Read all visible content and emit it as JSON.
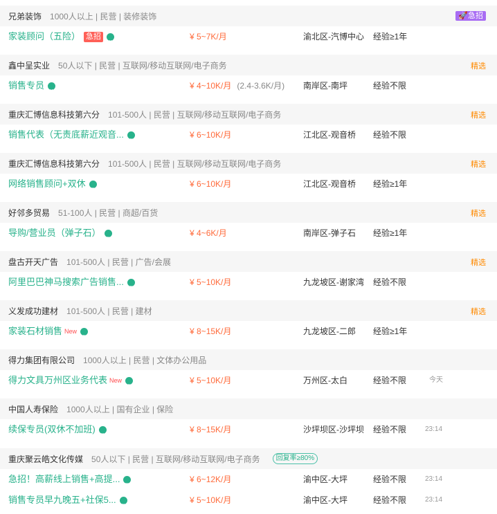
{
  "listings": [
    {
      "company": "兄弟装饰",
      "meta": "1000人以上 | 民营 | 装修装饰",
      "tag": "急招",
      "tag_type": "urgent",
      "jobs": [
        {
          "title": "家装顾问（五险）",
          "jizhao": "急招",
          "salary": "¥ 5~7K/月",
          "location": "渝北区-汽博中心",
          "exp": "经验≥1年"
        }
      ]
    },
    {
      "company": "鑫中呈实业",
      "meta": "50人以下 | 民营 | 互联网/移动互联网/电子商务",
      "tag": "精选",
      "tag_type": "featured",
      "jobs": [
        {
          "title": "销售专员",
          "salary": "¥ 4~10K/月",
          "salary_extra": "(2.4-3.6K/月)",
          "location": "南岸区-南坪",
          "exp": "经验不限"
        }
      ]
    },
    {
      "company": "重庆汇博信息科技第六分",
      "meta": "101-500人 | 民营 | 互联网/移动互联网/电子商务",
      "tag": "精选",
      "tag_type": "featured",
      "jobs": [
        {
          "title": "销售代表（无责底薪近观音...",
          "salary": "¥ 6~10K/月",
          "location": "江北区-观音桥",
          "exp": "经验不限"
        }
      ]
    },
    {
      "company": "重庆汇博信息科技第六分",
      "meta": "101-500人 | 民营 | 互联网/移动互联网/电子商务",
      "tag": "精选",
      "tag_type": "featured",
      "jobs": [
        {
          "title": "网络销售顾问+双休",
          "salary": "¥ 6~10K/月",
          "location": "江北区-观音桥",
          "exp": "经验≥1年"
        }
      ]
    },
    {
      "company": "好邻多贸易",
      "meta": "51-100人 | 民营 | 商超/百货",
      "tag": "精选",
      "tag_type": "featured",
      "jobs": [
        {
          "title": "导购/营业员（弹子石）",
          "salary": "¥ 4~6K/月",
          "location": "南岸区-弹子石",
          "exp": "经验≥1年"
        }
      ]
    },
    {
      "company": "盘古开天广告",
      "meta": "101-500人 | 民营 | 广告/会展",
      "tag": "精选",
      "tag_type": "featured",
      "jobs": [
        {
          "title": "阿里巴巴神马搜索广告销售...",
          "salary": "¥ 5~10K/月",
          "location": "九龙坡区-谢家湾",
          "exp": "经验不限"
        }
      ]
    },
    {
      "company": "义发成功建材",
      "meta": "101-500人 | 民营 | 建材",
      "tag": "精选",
      "tag_type": "featured",
      "jobs": [
        {
          "title": "家装石材销售",
          "new": "New",
          "salary": "¥ 8~15K/月",
          "location": "九龙坡区-二郎",
          "exp": "经验≥1年"
        }
      ]
    },
    {
      "company": "得力集团有限公司",
      "meta": "1000人以上 | 民营 | 文体办公用品",
      "jobs": [
        {
          "title": "得力文具万州区业务代表",
          "new": "New",
          "salary": "¥ 5~10K/月",
          "location": "万州区-太白",
          "exp": "经验不限",
          "time": "今天"
        }
      ]
    },
    {
      "company": "中国人寿保险",
      "meta": "1000人以上 | 国有企业 | 保险",
      "jobs": [
        {
          "title": "续保专员(双休不加班)",
          "salary": "¥ 8~15K/月",
          "location": "沙坪坝区-沙坪坝",
          "exp": "经验不限",
          "time": "23:14"
        }
      ]
    },
    {
      "company": "重庆聚云皓文化传媒",
      "meta": "50人以下 | 民营 | 互联网/移动互联网/电子商务",
      "rate": "回复率≥80%",
      "jobs": [
        {
          "title": "急招！高薪线上销售+高提...",
          "salary": "¥ 6~12K/月",
          "location": "渝中区-大坪",
          "exp": "经验不限",
          "time": "23:14"
        },
        {
          "title": "销售专员早九晚五+社保5...",
          "salary": "¥ 5~10K/月",
          "location": "渝中区-大坪",
          "exp": "经验不限",
          "time": "23:14"
        }
      ]
    }
  ]
}
